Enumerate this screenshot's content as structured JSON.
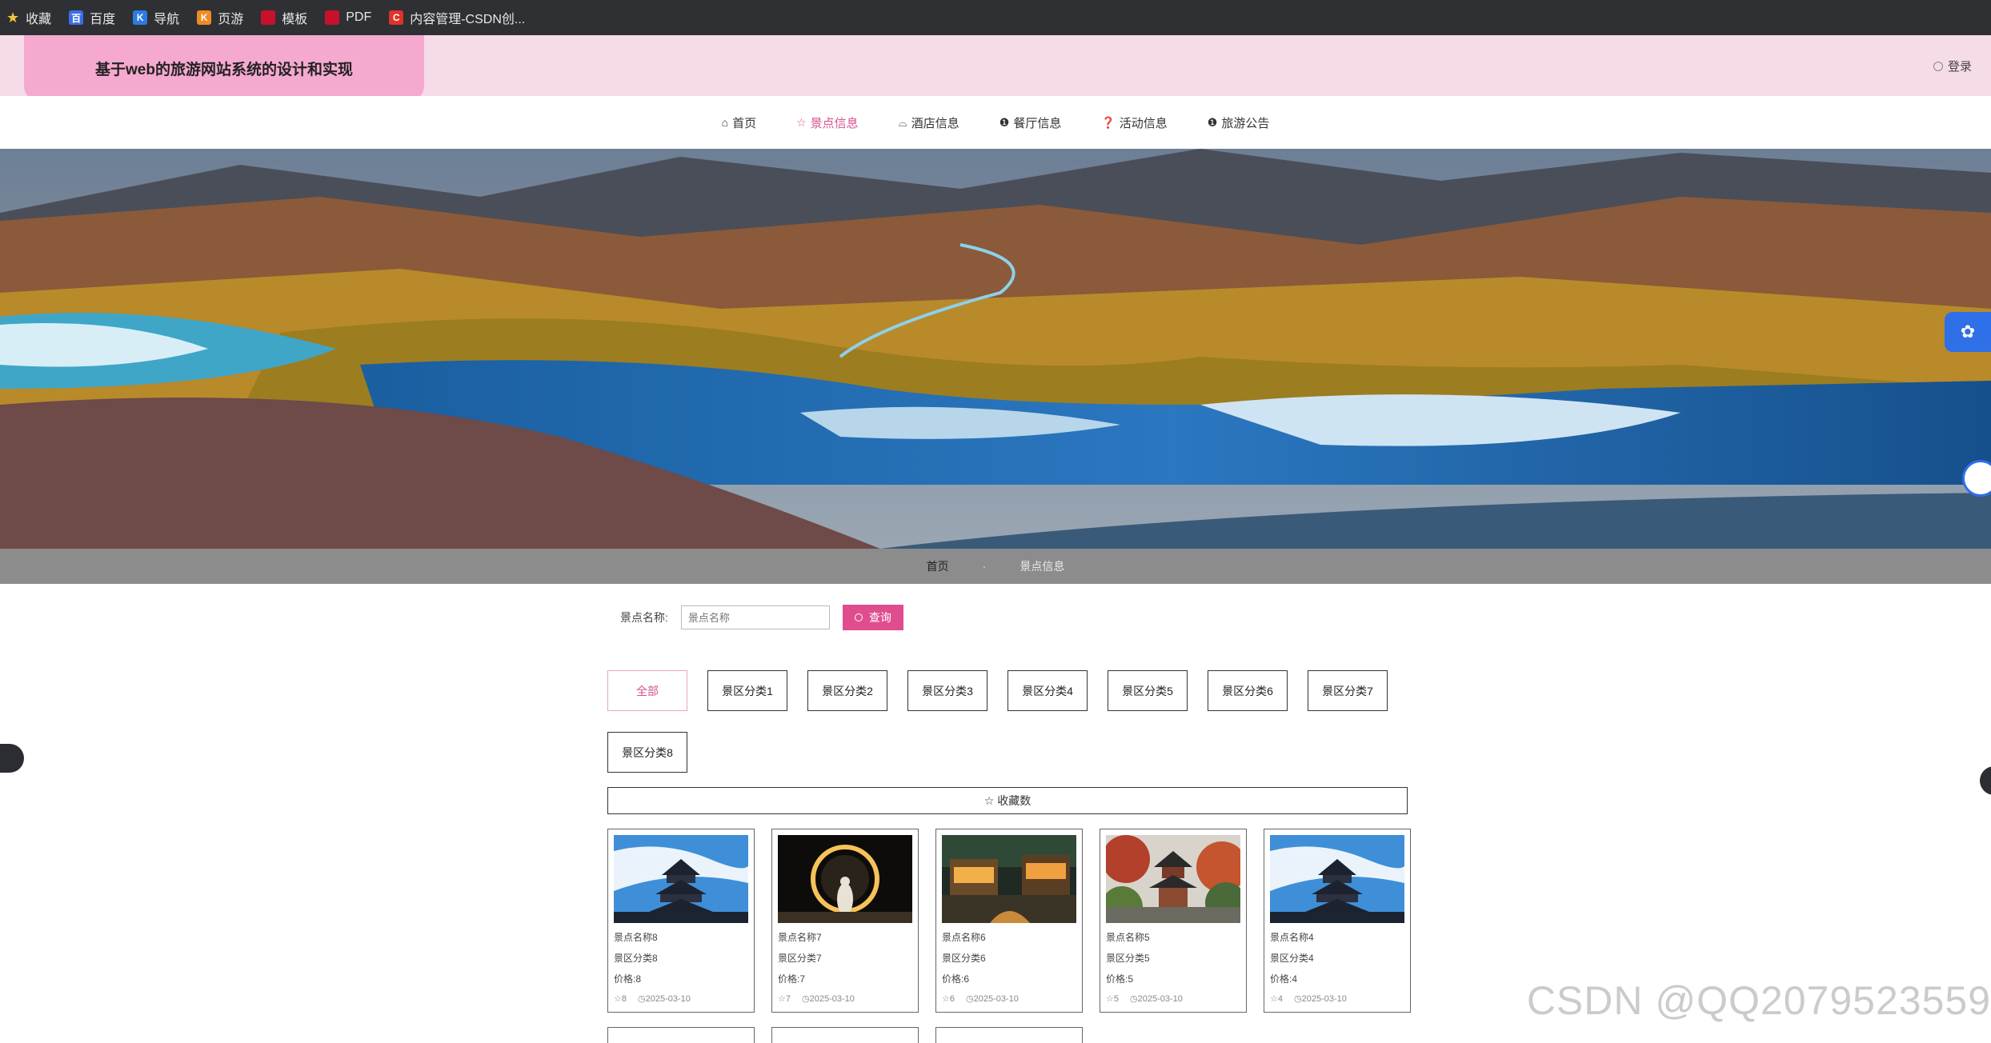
{
  "bookmarks": [
    {
      "label": "收藏",
      "icon": "star-icon"
    },
    {
      "label": "百度",
      "icon": "baidu-icon"
    },
    {
      "label": "导航",
      "icon": "nav-bookmark-icon"
    },
    {
      "label": "页游",
      "icon": "game-icon"
    },
    {
      "label": "模板",
      "icon": "template-icon"
    },
    {
      "label": "PDF",
      "icon": "pdf-icon"
    },
    {
      "label": "内容管理-CSDN创...",
      "icon": "csdn-icon"
    }
  ],
  "header": {
    "title": "基于web的旅游网站系统的设计和实现",
    "login": "登录"
  },
  "nav": [
    {
      "label": "首页",
      "icon": "home-icon"
    },
    {
      "label": "景点信息",
      "icon": "star-outline-icon"
    },
    {
      "label": "酒店信息",
      "icon": "hotel-icon"
    },
    {
      "label": "餐厅信息",
      "icon": "info-icon"
    },
    {
      "label": "活动信息",
      "icon": "question-icon"
    },
    {
      "label": "旅游公告",
      "icon": "info-icon"
    }
  ],
  "breadcrumb": {
    "home": "首页",
    "separator": "·",
    "current": "景点信息"
  },
  "search": {
    "label": "景点名称:",
    "placeholder": "景点名称",
    "button": "查询"
  },
  "categories": [
    "全部",
    "景区分类1",
    "景区分类2",
    "景区分类3",
    "景区分类4",
    "景区分类5",
    "景区分类6",
    "景区分类7",
    "景区分类8"
  ],
  "sort": {
    "label": "收藏数",
    "icon": "star-outline-icon"
  },
  "cards": [
    {
      "name": "景点名称8",
      "category": "景区分类8",
      "price": "价格:8",
      "favorites": "8",
      "date": "2025-03-10",
      "image": "temple-of-heaven"
    },
    {
      "name": "景点名称7",
      "category": "景区分类7",
      "price": "价格:7",
      "favorites": "7",
      "date": "2025-03-10",
      "image": "light-ring"
    },
    {
      "name": "景点名称6",
      "category": "景区分类6",
      "price": "价格:6",
      "favorites": "6",
      "date": "2025-03-10",
      "image": "night-town"
    },
    {
      "name": "景点名称5",
      "category": "景区分类5",
      "price": "价格:5",
      "favorites": "5",
      "date": "2025-03-10",
      "image": "pavilion"
    },
    {
      "name": "景点名称4",
      "category": "景区分类4",
      "price": "价格:4",
      "favorites": "4",
      "date": "2025-03-10",
      "image": "temple-of-heaven"
    }
  ],
  "watermark": "CSDN @QQ2079523559",
  "colors": {
    "accent": "#e04d8e",
    "header_bg": "#f6dbe8",
    "title_box": "#f6a9cf",
    "breadcrumb_bg": "#8c8c8c"
  }
}
